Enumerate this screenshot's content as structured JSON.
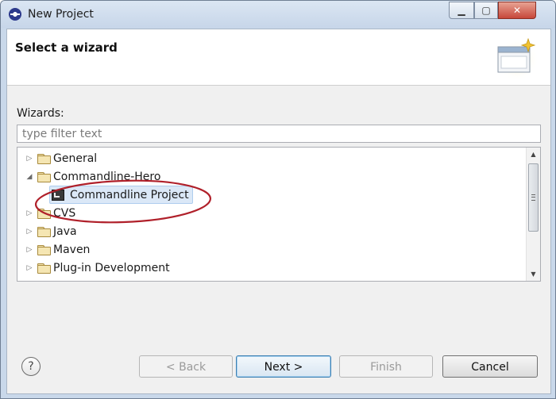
{
  "window": {
    "title": "New Project"
  },
  "header": {
    "title": "Select a wizard"
  },
  "wizards": {
    "label": "Wizards:",
    "filter_placeholder": "type filter text",
    "tree": [
      {
        "label": "General",
        "expanded": false
      },
      {
        "label": "Commandline-Hero",
        "expanded": true,
        "children": [
          {
            "label": "Commandline Project",
            "selected": true
          }
        ]
      },
      {
        "label": "CVS",
        "expanded": false
      },
      {
        "label": "Java",
        "expanded": false
      },
      {
        "label": "Maven",
        "expanded": false
      },
      {
        "label": "Plug-in Development",
        "expanded": false
      }
    ]
  },
  "buttons": {
    "back": "< Back",
    "next": "Next >",
    "finish": "Finish",
    "cancel": "Cancel"
  },
  "colors": {
    "highlight_ellipse": "#b0202a",
    "selection": "#dbe8f7"
  }
}
